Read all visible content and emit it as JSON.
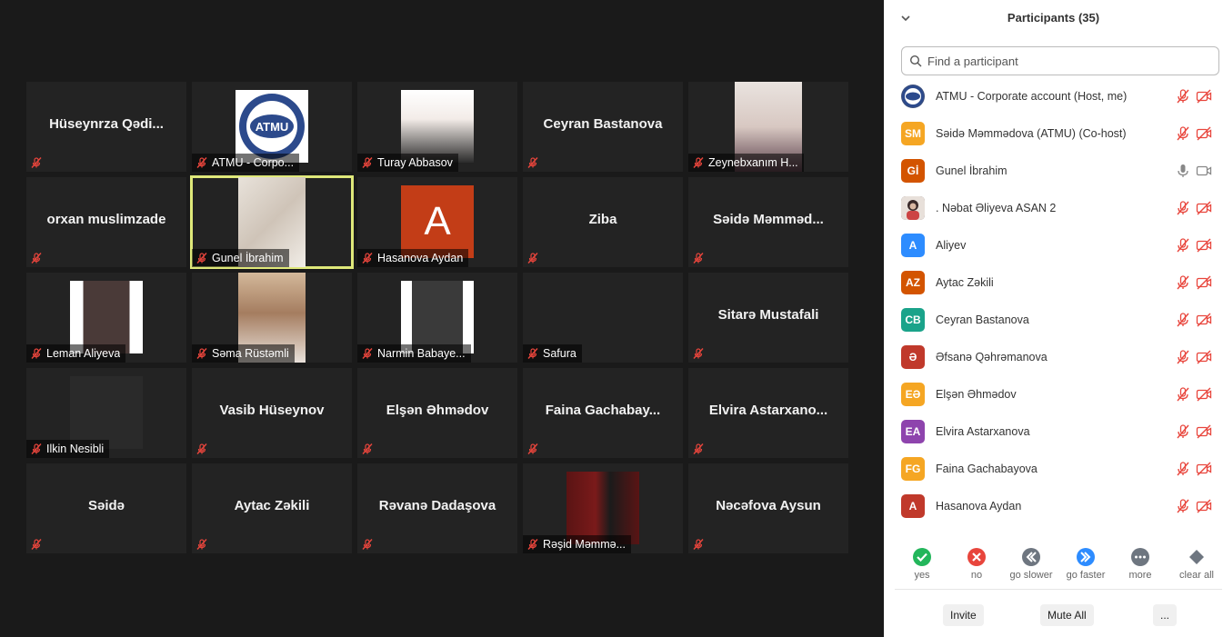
{
  "gallery": {
    "tiles": [
      {
        "name": "Hüseynrza  Qədi...",
        "label": ""
      },
      {
        "name": "",
        "label": "ATMU - Corpo..."
      },
      {
        "name": "",
        "label": "Turay Abbasov"
      },
      {
        "name": "Ceyran Bastanova",
        "label": ""
      },
      {
        "name": "",
        "label": "Zeynebxanım H..."
      },
      {
        "name": "orxan muslimzade",
        "label": ""
      },
      {
        "name": "",
        "label": "Gunel İbrahim"
      },
      {
        "name": "",
        "label": "Hasanova Aydan",
        "initial": "A"
      },
      {
        "name": "Ziba",
        "label": ""
      },
      {
        "name": "Səidə  Məmməd...",
        "label": ""
      },
      {
        "name": "",
        "label": "Leman Aliyeva"
      },
      {
        "name": "",
        "label": "Səma Rüstəmli"
      },
      {
        "name": "",
        "label": "Narmin Babaye..."
      },
      {
        "name": "",
        "label": "Safura"
      },
      {
        "name": "Sitarə Mustafali",
        "label": ""
      },
      {
        "name": "",
        "label": "Ilkin Nesibli"
      },
      {
        "name": "Vasib Hüseynov",
        "label": ""
      },
      {
        "name": "Elşən Əhmədov",
        "label": ""
      },
      {
        "name": "Faina  Gachabay...",
        "label": ""
      },
      {
        "name": "Elvira  Astarxano...",
        "label": ""
      },
      {
        "name": "Səidə",
        "label": ""
      },
      {
        "name": "Aytac Zəkili",
        "label": ""
      },
      {
        "name": "Rəvanə Dadaşova",
        "label": ""
      },
      {
        "name": "",
        "label": "Rəşid Məmmə..."
      },
      {
        "name": "Nəcəfova Aysun",
        "label": ""
      }
    ]
  },
  "panel": {
    "title": "Participants (35)",
    "search_placeholder": "Find a participant",
    "participants": [
      {
        "name": "ATMU - Corporate account (Host, me)",
        "initials": "",
        "color": "#3c4f7c",
        "mic": "muted",
        "cam": "off"
      },
      {
        "name": "Səidə Məmmədova (ATMU) (Co-host)",
        "initials": "SM",
        "color": "#f5a623",
        "mic": "muted",
        "cam": "off"
      },
      {
        "name": "Gunel İbrahim",
        "initials": "Gİ",
        "color": "#d35400",
        "mic": "on",
        "cam": "on"
      },
      {
        "name": ". Nəbat Əliyeva ASAN 2",
        "initials": "",
        "color": "#5a4a4a",
        "mic": "muted",
        "cam": "off"
      },
      {
        "name": "Aliyev",
        "initials": "A",
        "color": "#2d8cff",
        "mic": "muted",
        "cam": "off"
      },
      {
        "name": "Aytac Zəkili",
        "initials": "AZ",
        "color": "#d35400",
        "mic": "muted",
        "cam": "off"
      },
      {
        "name": "Ceyran Bastanova",
        "initials": "CB",
        "color": "#1aa38a",
        "mic": "muted",
        "cam": "off"
      },
      {
        "name": "Əfsanə Qəhrəmanova",
        "initials": "Ə",
        "color": "#c0392b",
        "mic": "muted",
        "cam": "off"
      },
      {
        "name": "Elşən Əhmədov",
        "initials": "EƏ",
        "color": "#f5a623",
        "mic": "muted",
        "cam": "off"
      },
      {
        "name": "Elvira Astarxanova",
        "initials": "EA",
        "color": "#8e44ad",
        "mic": "muted",
        "cam": "off"
      },
      {
        "name": "Faina Gachabayova",
        "initials": "FG",
        "color": "#f5a623",
        "mic": "muted",
        "cam": "off"
      },
      {
        "name": "Hasanova Aydan",
        "initials": "A",
        "color": "#c0392b",
        "mic": "muted",
        "cam": "off"
      }
    ],
    "reactions": [
      {
        "label": "yes",
        "color": "#23b65b",
        "icon": "check-icon"
      },
      {
        "label": "no",
        "color": "#e8453c",
        "icon": "x-icon"
      },
      {
        "label": "go slower",
        "color": "#6e7680",
        "icon": "rewind-icon"
      },
      {
        "label": "go faster",
        "color": "#2d8cff",
        "icon": "fast-forward-icon"
      },
      {
        "label": "more",
        "color": "#6e7680",
        "icon": "more-icon"
      },
      {
        "label": "clear all",
        "color": "#6e7680",
        "icon": "eraser-icon"
      }
    ],
    "footer": {
      "invite": "Invite",
      "mute_all": "Mute All",
      "more": "..."
    }
  }
}
